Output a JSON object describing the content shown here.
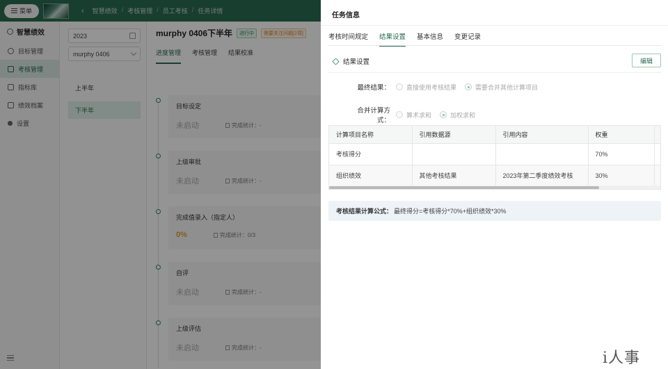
{
  "header": {
    "menu_label": "菜单",
    "breadcrumbs": [
      "智慧绩效",
      "考核管理",
      "员工考核",
      "任务详情"
    ]
  },
  "sidebar": {
    "app_title": "智慧绩效",
    "items": [
      {
        "label": "目标管理",
        "icon": "target-icon"
      },
      {
        "label": "考核管理",
        "icon": "clipboard-icon"
      },
      {
        "label": "指标库",
        "icon": "library-icon"
      },
      {
        "label": "绩效档案",
        "icon": "file-icon"
      },
      {
        "label": "设置",
        "icon": "gear-icon"
      }
    ]
  },
  "middle": {
    "year_value": "2023",
    "person_value": "murphy 0406",
    "periods": [
      "上半年",
      "下半年"
    ]
  },
  "main": {
    "title": "murphy 0406下半年",
    "status_tag": "进行中",
    "issue_tag": "需要关注问题[2项]",
    "tabs": [
      "进度管理",
      "考核管理",
      "结果校准"
    ],
    "steps": [
      {
        "name": "目标设定",
        "status": "未启动",
        "stat_label": "完成统计：-"
      },
      {
        "name": "上级审批",
        "status": "未启动",
        "stat_label": "完成统计：-"
      },
      {
        "name": "完成值录入（指定人）",
        "status": "0%",
        "stat_label": "完成统计：0/3"
      },
      {
        "name": "自评",
        "status": "未启动",
        "stat_label": "完成统计：-"
      },
      {
        "name": "上级评估",
        "status": "未启动",
        "stat_label": "完成统计：-"
      }
    ]
  },
  "drawer": {
    "title": "任务信息",
    "tabs": [
      "考核时间规定",
      "结果设置",
      "基本信息",
      "变更记录"
    ],
    "section_title": "结果设置",
    "edit_label": "编辑",
    "final_result": {
      "label": "最终结果：",
      "options": [
        "直接使用考核结果",
        "需要合并其他计算项目"
      ],
      "selected": 1
    },
    "calc_method": {
      "label": "合并计算方式：",
      "options": [
        "算术求和",
        "加权求和"
      ],
      "selected": 1
    },
    "table": {
      "headers": [
        "计算项目名称",
        "引用数据源",
        "引用内容",
        "权重"
      ],
      "rows": [
        [
          "考核得分",
          "",
          "",
          "70%"
        ],
        [
          "组织绩效",
          "其他考核结果",
          "2023年第二季度绩效考核",
          "30%"
        ]
      ]
    },
    "formula_label": "考核结果计算公式：",
    "formula_text": "最终得分=考核得分*70%+组织绩效*30%"
  },
  "watermark": "i人事",
  "colors": {
    "brand": "#2a6b52",
    "accent": "#2a8a5a",
    "warning": "#e39b2b"
  }
}
